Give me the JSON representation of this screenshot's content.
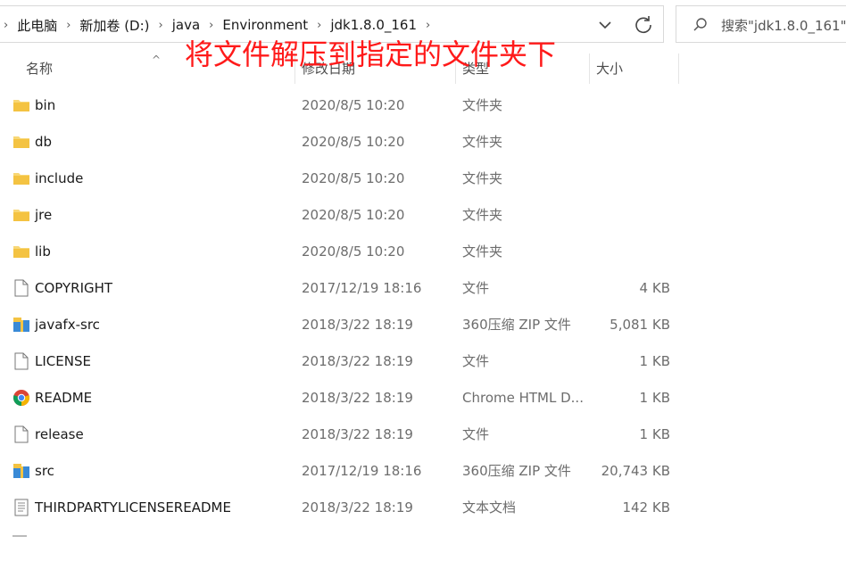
{
  "breadcrumb": {
    "items": [
      "此电脑",
      "新加卷 (D:)",
      "java",
      "Environment",
      "jdk1.8.0_161"
    ],
    "separator": "›"
  },
  "search": {
    "placeholder": "搜索\"jdk1.8.0_161\""
  },
  "annotation": {
    "text": "将文件解压到指定的文件夹下",
    "color": "#ff1a1a"
  },
  "columns": {
    "name": "名称",
    "modified": "修改日期",
    "type": "类型",
    "size": "大小"
  },
  "files": [
    {
      "name": "bin",
      "modified": "2020/8/5 10:20",
      "type": "文件夹",
      "size": "",
      "icon": "folder-icon"
    },
    {
      "name": "db",
      "modified": "2020/8/5 10:20",
      "type": "文件夹",
      "size": "",
      "icon": "folder-icon"
    },
    {
      "name": "include",
      "modified": "2020/8/5 10:20",
      "type": "文件夹",
      "size": "",
      "icon": "folder-icon"
    },
    {
      "name": "jre",
      "modified": "2020/8/5 10:20",
      "type": "文件夹",
      "size": "",
      "icon": "folder-icon"
    },
    {
      "name": "lib",
      "modified": "2020/8/5 10:20",
      "type": "文件夹",
      "size": "",
      "icon": "folder-icon"
    },
    {
      "name": "COPYRIGHT",
      "modified": "2017/12/19 18:16",
      "type": "文件",
      "size": "4 KB",
      "icon": "file-icon"
    },
    {
      "name": "javafx-src",
      "modified": "2018/3/22 18:19",
      "type": "360压缩 ZIP 文件",
      "size": "5,081 KB",
      "icon": "zip-archive-icon"
    },
    {
      "name": "LICENSE",
      "modified": "2018/3/22 18:19",
      "type": "文件",
      "size": "1 KB",
      "icon": "file-icon"
    },
    {
      "name": "README",
      "modified": "2018/3/22 18:19",
      "type": "Chrome HTML D...",
      "size": "1 KB",
      "icon": "chrome-icon"
    },
    {
      "name": "release",
      "modified": "2018/3/22 18:19",
      "type": "文件",
      "size": "1 KB",
      "icon": "file-icon"
    },
    {
      "name": "src",
      "modified": "2017/12/19 18:16",
      "type": "360压缩 ZIP 文件",
      "size": "20,743 KB",
      "icon": "zip-archive-icon"
    },
    {
      "name": "THIRDPARTYLICENSEREADME",
      "modified": "2018/3/22 18:19",
      "type": "文本文档",
      "size": "142 KB",
      "icon": "text-document-icon"
    }
  ]
}
